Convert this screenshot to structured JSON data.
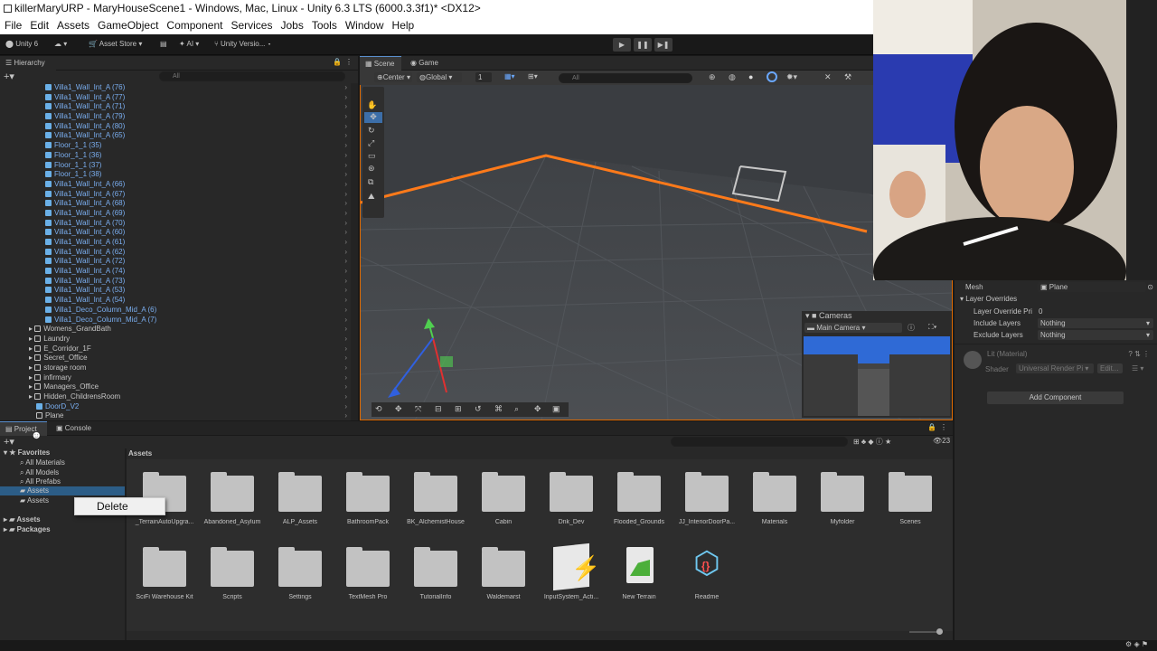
{
  "window": {
    "title": "killerMaryURP - MaryHouseScene1 - Windows, Mac, Linux - Unity 6.3 LTS (6000.3.3f1)* <DX12>"
  },
  "menu": [
    "File",
    "Edit",
    "Assets",
    "GameObject",
    "Component",
    "Services",
    "Jobs",
    "Tools",
    "Window",
    "Help"
  ],
  "toolbar": {
    "unity_label": "Unity 6",
    "asset_store": "Asset Store",
    "ai": "AI",
    "version_control": "Unity Versio..."
  },
  "hierarchy": {
    "tab": "Hierarchy",
    "search_placeholder": "All",
    "items": [
      {
        "label": "Villa1_Wall_Int_A (76)",
        "kind": "blue"
      },
      {
        "label": "Villa1_Wall_Int_A (77)",
        "kind": "blue"
      },
      {
        "label": "Villa1_Wall_Int_A (71)",
        "kind": "blue"
      },
      {
        "label": "Villa1_Wall_Int_A (79)",
        "kind": "blue"
      },
      {
        "label": "Villa1_Wall_Int_A (80)",
        "kind": "blue"
      },
      {
        "label": "Villa1_Wall_Int_A (65)",
        "kind": "blue"
      },
      {
        "label": "Floor_1_1 (35)",
        "kind": "blue"
      },
      {
        "label": "Floor_1_1 (36)",
        "kind": "blue"
      },
      {
        "label": "Floor_1_1 (37)",
        "kind": "blue"
      },
      {
        "label": "Floor_1_1 (38)",
        "kind": "blue"
      },
      {
        "label": "Villa1_Wall_Int_A (66)",
        "kind": "blue"
      },
      {
        "label": "Villa1_Wall_Int_A (67)",
        "kind": "blue"
      },
      {
        "label": "Villa1_Wall_Int_A (68)",
        "kind": "blue"
      },
      {
        "label": "Villa1_Wall_Int_A (69)",
        "kind": "blue"
      },
      {
        "label": "Villa1_Wall_Int_A (70)",
        "kind": "blue"
      },
      {
        "label": "Villa1_Wall_Int_A (60)",
        "kind": "blue"
      },
      {
        "label": "Villa1_Wall_Int_A (61)",
        "kind": "blue"
      },
      {
        "label": "Villa1_Wall_Int_A (62)",
        "kind": "blue"
      },
      {
        "label": "Villa1_Wall_Int_A (72)",
        "kind": "blue"
      },
      {
        "label": "Villa1_Wall_Int_A (74)",
        "kind": "blue"
      },
      {
        "label": "Villa1_Wall_Int_A (73)",
        "kind": "blue"
      },
      {
        "label": "Villa1_Wall_Int_A (53)",
        "kind": "blue"
      },
      {
        "label": "Villa1_Wall_Int_A (54)",
        "kind": "blue"
      },
      {
        "label": "Villa1_Deco_Column_Mid_A (6)",
        "kind": "blue"
      },
      {
        "label": "Villa1_Deco_Column_Mid_A (7)",
        "kind": "blue"
      },
      {
        "label": "Womens_GrandBath",
        "kind": "grey"
      },
      {
        "label": "Laundry",
        "kind": "grey"
      },
      {
        "label": "E_Corridor_1F",
        "kind": "grey"
      },
      {
        "label": "Secret_Office",
        "kind": "grey"
      },
      {
        "label": "storage room",
        "kind": "grey"
      },
      {
        "label": "infirmary",
        "kind": "grey"
      },
      {
        "label": "Managers_Office",
        "kind": "grey"
      },
      {
        "label": "Hidden_ChildrensRoom",
        "kind": "grey"
      },
      {
        "label": "DoorD_V2",
        "kind": "blue"
      },
      {
        "label": "Plane",
        "kind": "grey"
      }
    ]
  },
  "scene": {
    "tabs": [
      "Scene",
      "Game"
    ],
    "pivot": "Center",
    "space": "Global",
    "grid_value": "1",
    "search_placeholder": "All",
    "cameras_overlay": {
      "title": "Cameras",
      "selected": "Main Camera"
    }
  },
  "project": {
    "tabs": [
      "Project",
      "Console"
    ],
    "breadcrumb": "Assets",
    "item_count": "23",
    "sidebar": {
      "favorites_label": "Favorites",
      "favorites": [
        "All Materials",
        "All Models",
        "All Prefabs",
        "Assets",
        "Assets"
      ],
      "roots": [
        "Assets",
        "Packages"
      ]
    },
    "context_menu": {
      "item": "Delete"
    },
    "assets": [
      {
        "name": "_TerrainAutoUpgra...",
        "type": "folder"
      },
      {
        "name": "Abandoned_Asylum",
        "type": "folder"
      },
      {
        "name": "ALP_Assets",
        "type": "folder"
      },
      {
        "name": "BathroomPack",
        "type": "folder"
      },
      {
        "name": "BK_AlchemistHouse",
        "type": "folder"
      },
      {
        "name": "Cabin",
        "type": "folder"
      },
      {
        "name": "Dnk_Dev",
        "type": "folder"
      },
      {
        "name": "Flooded_Grounds",
        "type": "folder"
      },
      {
        "name": "JJ_InteriorDoorPa...",
        "type": "folder"
      },
      {
        "name": "Materials",
        "type": "folder"
      },
      {
        "name": "Myfolder",
        "type": "folder"
      },
      {
        "name": "Scenes",
        "type": "folder"
      },
      {
        "name": "SciFi Warehouse Kit",
        "type": "folder"
      },
      {
        "name": "Scripts",
        "type": "folder"
      },
      {
        "name": "Settings",
        "type": "folder"
      },
      {
        "name": "TextMesh Pro",
        "type": "folder"
      },
      {
        "name": "TutorialInfo",
        "type": "folder"
      },
      {
        "name": "Waldemarst",
        "type": "folder"
      },
      {
        "name": "InputSystem_Acti...",
        "type": "input-actions"
      },
      {
        "name": "New Terrain",
        "type": "terrain"
      },
      {
        "name": "Readme",
        "type": "readme"
      }
    ]
  },
  "inspector": {
    "mesh_label": "Mesh",
    "mesh_value": "Plane",
    "layer_overrides": "Layer Overrides",
    "layer_override_priority_label": "Layer Override Pri",
    "layer_override_priority_value": "0",
    "include_layers_label": "Include Layers",
    "include_layers_value": "Nothing",
    "exclude_layers_label": "Exclude Layers",
    "exclude_layers_value": "Nothing",
    "material_name": "Lit (Material)",
    "shader_label": "Shader",
    "shader_value": "Universal Render Pi",
    "edit_label": "Edit...",
    "add_component": "Add Component"
  },
  "colors": {
    "accent": "#2c5d87",
    "selection_outline": "#e06a00",
    "prefab_blue": "#7aaef0"
  }
}
